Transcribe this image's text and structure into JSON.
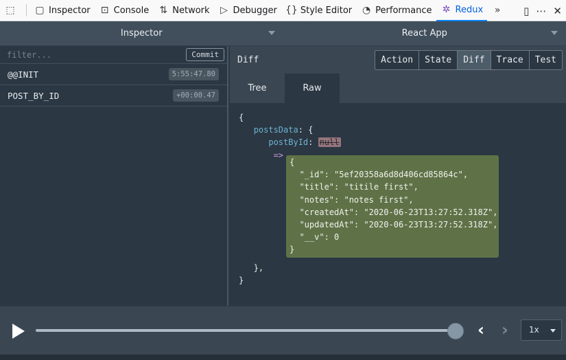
{
  "toolbar": {
    "items": [
      {
        "label": "Inspector",
        "icon": "inspector-icon"
      },
      {
        "label": "Console",
        "icon": "console-icon"
      },
      {
        "label": "Network",
        "icon": "network-icon"
      },
      {
        "label": "Debugger",
        "icon": "debugger-icon"
      },
      {
        "label": "Style Editor",
        "icon": "style-editor-icon"
      },
      {
        "label": "Performance",
        "icon": "performance-icon"
      },
      {
        "label": "Redux",
        "icon": "redux-icon"
      }
    ],
    "active": "Redux"
  },
  "selectors": {
    "left": "Inspector",
    "right": "React App"
  },
  "actions": {
    "filter_placeholder": "filter...",
    "commit_label": "Commit",
    "items": [
      {
        "name": "@@INIT",
        "time": "5:55:47.80"
      },
      {
        "name": "POST_BY_ID",
        "time": "+00:00.47"
      }
    ]
  },
  "monitor": {
    "title": "Diff",
    "tabs": [
      "Action",
      "State",
      "Diff",
      "Trace",
      "Test"
    ],
    "active_tab": "Diff",
    "subtabs": [
      "Tree",
      "Raw"
    ],
    "active_subtab": "Raw"
  },
  "diff": {
    "open": "{",
    "posts_key": "postsData",
    "postbyid_key": "postById",
    "old_value": "null",
    "arrow": "=>",
    "new_lines": [
      "{",
      "  \"_id\": \"5ef20358a6d8d406cd85864c\",",
      "  \"title\": \"titile first\",",
      "  \"notes\": \"notes first\",",
      "  \"createdAt\": \"2020-06-23T13:27:52.318Z\",",
      "  \"updatedAt\": \"2020-06-23T13:27:52.318Z\",",
      "  \"__v\": 0",
      "}"
    ],
    "close_inner": "},",
    "close_outer": "}"
  },
  "slider": {
    "speed": "1x",
    "progress": 1.0
  }
}
